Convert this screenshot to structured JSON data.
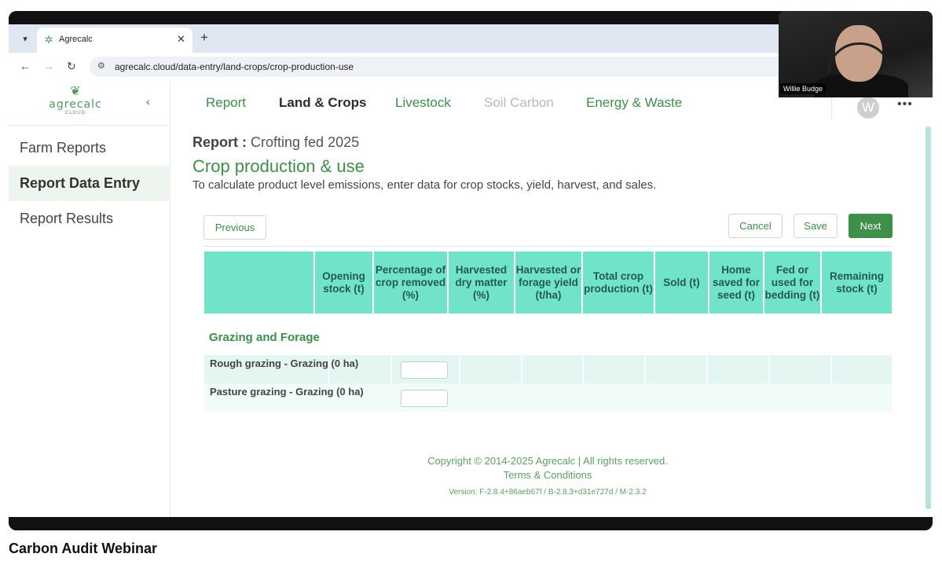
{
  "browser": {
    "tab_title": "Agrecalc",
    "tab_close": "✕",
    "new_tab": "+",
    "url": "agrecalc.cloud/data-entry/land-crops/crop-production-use"
  },
  "sidebar": {
    "logo_text": "agrecalc",
    "logo_sub": "CLOUD",
    "items": [
      {
        "label": "Farm Reports"
      },
      {
        "label": "Report Data Entry"
      },
      {
        "label": "Report Results"
      }
    ]
  },
  "topnav": {
    "items": [
      {
        "label": "Report"
      },
      {
        "label": "Land & Crops"
      },
      {
        "label": "Livestock"
      },
      {
        "label": "Soil Carbon"
      },
      {
        "label": "Energy & Waste"
      }
    ],
    "avatar_initial": "W"
  },
  "page": {
    "report_prefix": "Report :",
    "report_name": "Crofting fed 2025",
    "title": "Crop production & use",
    "description": "To calculate product level emissions, enter data for crop stocks, yield, harvest, and sales."
  },
  "actions": {
    "previous": "Previous",
    "cancel": "Cancel",
    "save": "Save",
    "next": "Next"
  },
  "table": {
    "headers": [
      "",
      "Opening stock (t)",
      "Percentage of crop removed (%)",
      "Harvested dry matter (%)",
      "Harvested or forage yield (t/ha)",
      "Total crop production (t)",
      "Sold (t)",
      "Home saved for seed (t)",
      "Fed or used for bedding (t)",
      "Remaining stock (t)"
    ],
    "group": "Grazing and Forage",
    "rows": [
      {
        "label": "Rough grazing - Grazing (0 ha)",
        "percentage_removed": ""
      },
      {
        "label": "Pasture grazing - Grazing (0 ha)",
        "percentage_removed": ""
      }
    ]
  },
  "footer": {
    "copyright": "Copyright © 2014-2025 Agrecalc | All rights reserved.",
    "terms": "Terms & Conditions",
    "version": "Version: F-2.8.4+86aeb67f / B-2.8.3+d31e727d / M-2.3.2"
  },
  "webcam": {
    "name": "Willie Budge"
  },
  "caption": "Carbon Audit Webinar"
}
